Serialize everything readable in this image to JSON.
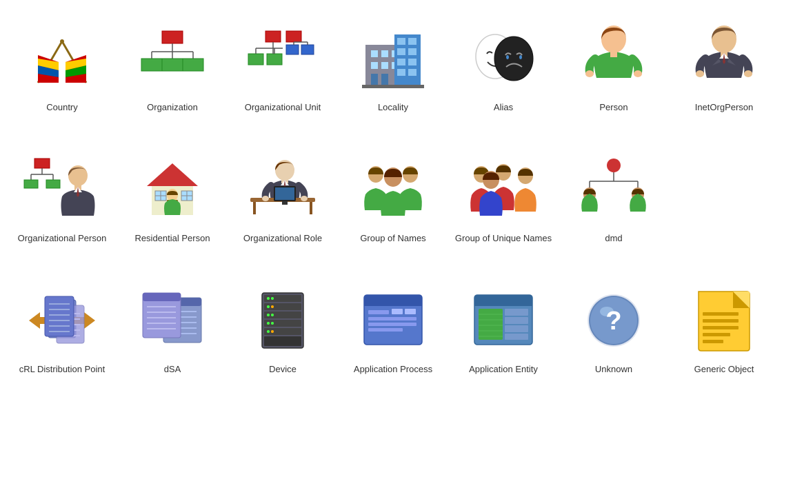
{
  "items": [
    {
      "id": "country",
      "label": "Country",
      "row": 1
    },
    {
      "id": "organization",
      "label": "Organization",
      "row": 1
    },
    {
      "id": "organizational-unit",
      "label": "Organizational Unit",
      "row": 1
    },
    {
      "id": "locality",
      "label": "Locality",
      "row": 1
    },
    {
      "id": "alias",
      "label": "Alias",
      "row": 1
    },
    {
      "id": "person",
      "label": "Person",
      "row": 1
    },
    {
      "id": "inetorgperson",
      "label": "InetOrgPerson",
      "row": 1
    },
    {
      "id": "organizational-person",
      "label": "Organizational Person",
      "row": 2
    },
    {
      "id": "residential-person",
      "label": "Residential Person",
      "row": 2
    },
    {
      "id": "organizational-role",
      "label": "Organizational Role",
      "row": 2
    },
    {
      "id": "group-of-names",
      "label": "Group of Names",
      "row": 2
    },
    {
      "id": "group-of-unique-names",
      "label": "Group of Unique Names",
      "row": 2
    },
    {
      "id": "dmd",
      "label": "dmd",
      "row": 2
    },
    {
      "id": "crl-distribution-point",
      "label": "cRL Distribution Point",
      "row": 3
    },
    {
      "id": "dsa",
      "label": "dSA",
      "row": 3
    },
    {
      "id": "device",
      "label": "Device",
      "row": 3
    },
    {
      "id": "application-process",
      "label": "Application Process",
      "row": 3
    },
    {
      "id": "application-entity",
      "label": "Application Entity",
      "row": 3
    },
    {
      "id": "unknown",
      "label": "Unknown",
      "row": 3
    },
    {
      "id": "generic-object",
      "label": "Generic Object",
      "row": 3
    }
  ]
}
